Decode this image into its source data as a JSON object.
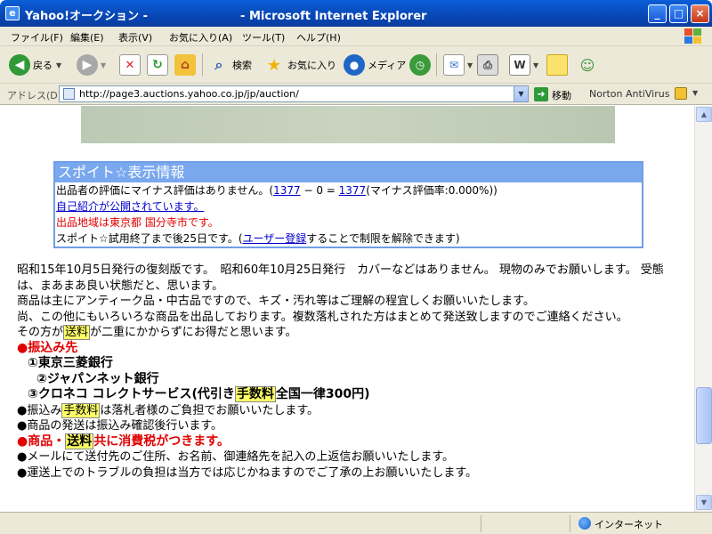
{
  "window": {
    "title": "Yahoo!オークション -                       - Microsoft Internet Explorer",
    "minimize": "_",
    "maximize": "□",
    "close": "×"
  },
  "menu": [
    "ファイル(F)",
    "編集(E)",
    "表示(V)",
    "お気に入り(A)",
    "ツール(T)",
    "ヘルプ(H)"
  ],
  "toolbar": {
    "back": "戻る",
    "search": "検索",
    "favorites": "お気に入り",
    "media": "メディア"
  },
  "address": {
    "label": "アドレス(D)",
    "url": "http://page3.auctions.yahoo.co.jp/jp/auction/",
    "go": "移動",
    "addon": "Norton AntiVirus"
  },
  "info_box": {
    "heading": "スポイト☆表示情報",
    "rating_prefix": "出品者の評価にマイナス評価はありません。(",
    "rating_total": "1377",
    "rating_mid": " − 0 = ",
    "rating_net": "1377",
    "rating_suffix": "(マイナス評価率:0.000%))",
    "intro_link": "自己紹介が公開されています。",
    "region": "出品地域は東京都 国分寺市です。",
    "trial_prefix": "スポイト☆試用終了まで後25日です。(",
    "trial_link": "ユーザー登録",
    "trial_suffix": "することで制限を解除できます)"
  },
  "body": {
    "p1": "昭和15年10月5日発行の復刻版です。　昭和60年10月25日発行　カバーなどはありません。 現物のみでお願いします。 受態は、まあまあ良い状態だと、思います。",
    "p2": "商品は主にアンティーク品・中古品ですので、キズ・汚れ等はご理解の程宜しくお願いいたします。",
    "p3": "尚、この他にもいろいろな商品を出品しております。複数落札された方はまとめて発送致しますのでご連絡ください。",
    "p4_pre": "その方が",
    "p4_hl": "送料",
    "p4_post": "が二重にかからずにお得だと思います。",
    "bank_title": "●振込み先",
    "bank1": "①東京三菱銀行",
    "bank2": "②ジャパンネット銀行",
    "bank3_pre": "③クロネコ コレクトサービス(代引き",
    "bank3_hl": "手数料",
    "bank3_post": "全国一律300円)",
    "fee_pre": "●振込み",
    "fee_hl": "手数料",
    "fee_post": "は落札者様のご負担でお願いいたします。",
    "ship": "●商品の発送は振込み確認後行います。",
    "tax_pre": "●商品・",
    "tax_hl": "送料",
    "tax_post": "共に消費税がつきます。",
    "mail": "●メールにて送付先のご住所、お名前、御連絡先を記入の上返信お願いいたします。",
    "trouble": "●運送上でのトラブルの負担は当方では応じかねますのでご了承の上お願いいたします。"
  },
  "status": {
    "zone": "インターネット"
  },
  "colors": {
    "titlebar": "#0846b4",
    "info_border": "#6f9ee6",
    "link": "#0000cc",
    "red": "#e00000",
    "highlight": "#ffff66"
  }
}
